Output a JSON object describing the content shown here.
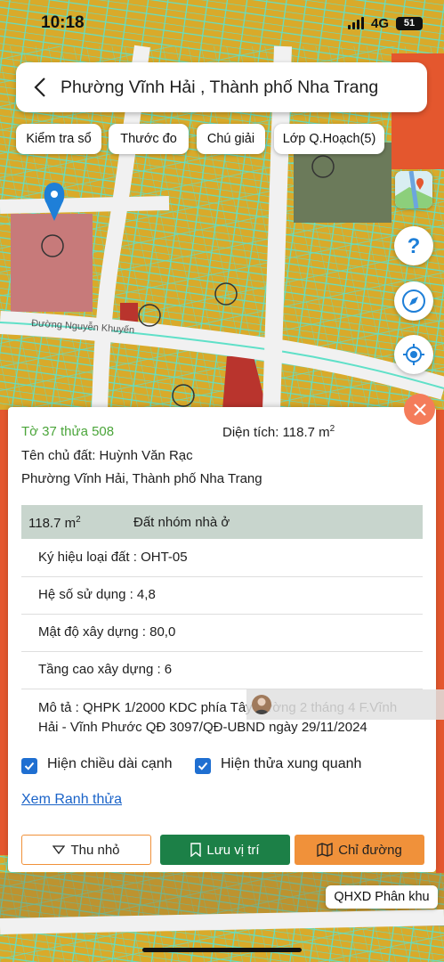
{
  "status_bar": {
    "time": "10:18",
    "network": "4G",
    "battery": "51"
  },
  "header": {
    "title": "Phường Vĩnh Hải , Thành phố Nha Trang"
  },
  "toolbar": {
    "check_label": "Kiểm tra sổ",
    "ruler_label": "Thước đo",
    "legend_label": "Chú giải",
    "layers_label": "Lớp Q.Hoạch(5)"
  },
  "map": {
    "street_label": "Đường Nguyễn Khuyến",
    "colors": {
      "residential": "#d9aa2a",
      "parcel_lines": "#5fe0c8",
      "commercial": "#e4572e",
      "public": "#c77a7a",
      "green": "#6b7a5a"
    },
    "icons": [
      "map-pin-icon",
      "help-icon",
      "compass-icon",
      "locate-icon",
      "satellite-layer-icon"
    ]
  },
  "info": {
    "parcel": "Tờ 37 thửa 508",
    "area_label": "Diện tích: 118.7 m",
    "area_sup": "2",
    "owner_label": "Tên chủ đất: Huỳnh Văn Rạc",
    "address": "Phường Vĩnh Hải, Thành phố Nha Trang",
    "table_area": "118.7 m",
    "table_area_sup": "2",
    "table_group": "Đất nhóm nhà ở",
    "rows": {
      "land_code": "Ký hiệu loại đất : OHT-05",
      "usage_ratio": "Hệ số sử dụng : 4,8",
      "density": "Mật độ xây dựng : 80,0",
      "height": "Tầng cao xây dựng : 6"
    },
    "description_line1": "Mô tả : QHPK 1/2000 KDC phía Tây đường 2 tháng 4 F.Vĩnh",
    "description_line2": "Hải - Vĩnh Phước QĐ 3097/QĐ-UBND ngày 29/11/2024",
    "checkbox_edges": "Hiện chiều dài cạnh",
    "checkbox_neighbors": "Hiện thửa xung quanh",
    "link_boundary": "Xem Ranh thửa",
    "btn_collapse": "Thu nhỏ",
    "btn_save": "Lưu vị trí",
    "btn_directions": "Chỉ đường"
  },
  "zone_badge": "QHXD Phân khu",
  "colors": {
    "accent_orange": "#f0913a",
    "save_green": "#1c8047",
    "close_bg": "#f47c5a",
    "table_head": "#c8d5cd"
  }
}
